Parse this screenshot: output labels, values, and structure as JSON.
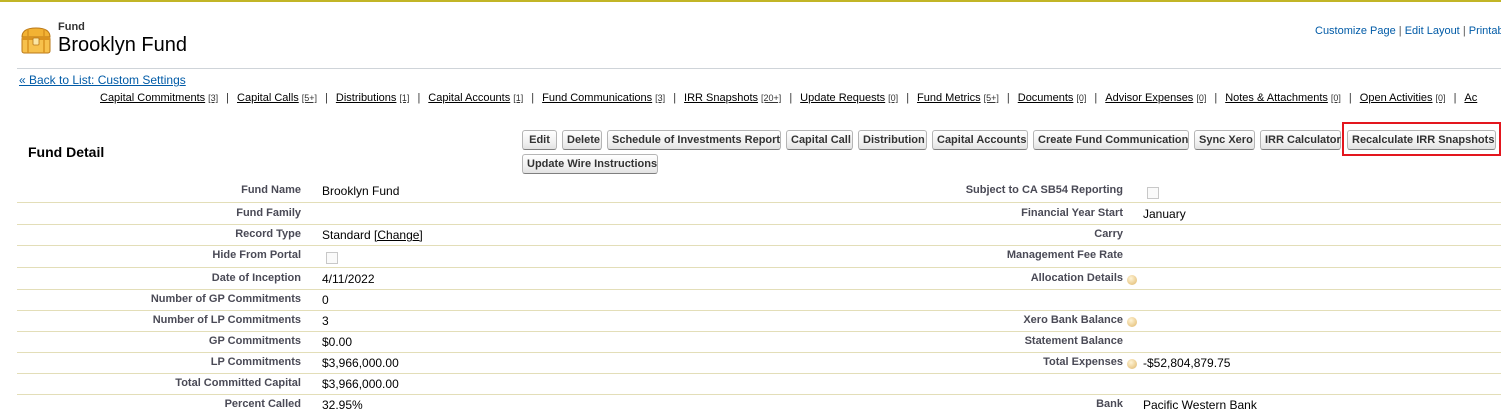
{
  "header": {
    "object_type": "Fund",
    "record_name": "Brooklyn Fund",
    "links": [
      "Customize Page",
      "Edit Layout",
      "Printab"
    ]
  },
  "back_link": "« Back to List: Custom Settings",
  "related_lists": [
    {
      "label": "Capital Commitments",
      "count": "[3]"
    },
    {
      "label": "Capital Calls",
      "count": "[5+]"
    },
    {
      "label": "Distributions",
      "count": "[1]"
    },
    {
      "label": "Capital Accounts",
      "count": "[1]"
    },
    {
      "label": "Fund Communications",
      "count": "[3]"
    },
    {
      "label": "IRR Snapshots",
      "count": "[20+]"
    },
    {
      "label": "Update Requests",
      "count": "[0]"
    },
    {
      "label": "Fund Metrics",
      "count": "[5+]"
    },
    {
      "label": "Documents",
      "count": "[0]"
    },
    {
      "label": "Advisor Expenses",
      "count": "[0]"
    },
    {
      "label": "Notes & Attachments",
      "count": "[0]"
    },
    {
      "label": "Open Activities",
      "count": "[0]"
    },
    {
      "label": "Ac",
      "count": ""
    }
  ],
  "detail": {
    "section_title": "Fund Detail",
    "buttons": {
      "edit": "Edit",
      "delete": "Delete",
      "schedule": "Schedule of Investments Report",
      "capital_call": "Capital Call",
      "distribution": "Distribution",
      "capital_accounts": "Capital Accounts",
      "create_comm": "Create Fund Communication",
      "sync_xero": "Sync Xero",
      "irr_calc": "IRR Calculator",
      "recalc_irr": "Recalculate IRR Snapshots",
      "update_wire": "Update Wire Instructions"
    },
    "left": {
      "fund_name_label": "Fund Name",
      "fund_name": "Brooklyn Fund",
      "fund_family_label": "Fund Family",
      "record_type_label": "Record Type",
      "record_type": "Standard",
      "change_link": "[Change]",
      "hide_portal_label": "Hide From Portal",
      "inception_label": "Date of Inception",
      "inception": "4/11/2022",
      "num_gp_label": "Number of GP Commitments",
      "num_gp": "0",
      "num_lp_label": "Number of LP Commitments",
      "num_lp": "3",
      "gp_label": "GP Commitments",
      "gp": "$0.00",
      "lp_label": "LP Commitments",
      "lp": "$3,966,000.00",
      "total_label": "Total Committed Capital",
      "total": "$3,966,000.00",
      "pct_label": "Percent Called",
      "pct": "32.95%"
    },
    "right": {
      "sb54_label": "Subject to CA SB54 Reporting",
      "fy_label": "Financial Year Start",
      "fy": "January",
      "carry_label": "Carry",
      "mgmt_label": "Management Fee Rate",
      "alloc_label": "Allocation Details",
      "xero_label": "Xero Bank Balance",
      "stmt_label": "Statement Balance",
      "exp_label": "Total Expenses",
      "exp": "-$52,804,879.75",
      "bank_label": "Bank",
      "bank": "Pacific Western Bank"
    }
  }
}
